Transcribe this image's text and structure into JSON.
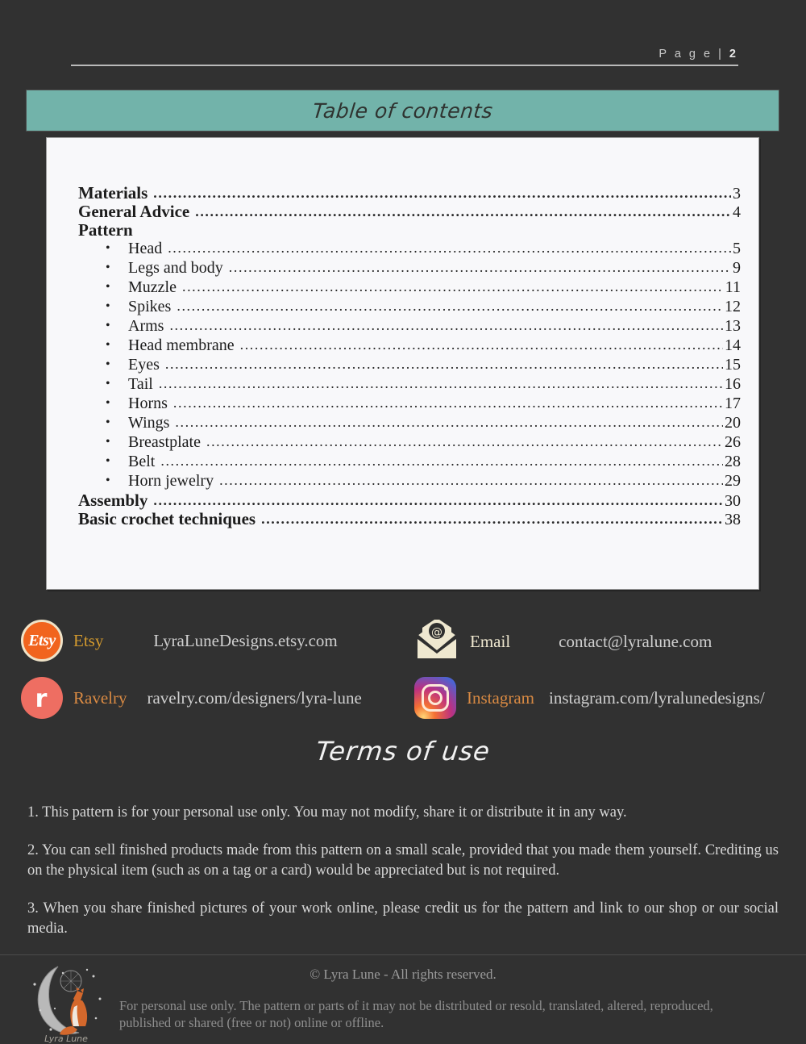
{
  "header": {
    "page_label": "P a g e  | ",
    "page_number": "2"
  },
  "toc": {
    "bar_title": "Table of contents",
    "entries": [
      {
        "label": "Materials",
        "page": "3",
        "level": 0,
        "bullet": false
      },
      {
        "label": "General Advice",
        "page": "4",
        "level": 0,
        "bullet": false
      },
      {
        "label": "Pattern",
        "page": "",
        "level": 0,
        "bullet": false,
        "nodots": true
      },
      {
        "label": "Head",
        "page": "5",
        "level": 1,
        "bullet": true
      },
      {
        "label": "Legs and body",
        "page": "9",
        "level": 1,
        "bullet": true
      },
      {
        "label": "Muzzle",
        "page": "11",
        "level": 1,
        "bullet": true
      },
      {
        "label": "Spikes",
        "page": "12",
        "level": 1,
        "bullet": true
      },
      {
        "label": "Arms",
        "page": "13",
        "level": 1,
        "bullet": true
      },
      {
        "label": "Head membrane",
        "page": "14",
        "level": 1,
        "bullet": true
      },
      {
        "label": "Eyes",
        "page": "15",
        "level": 1,
        "bullet": true
      },
      {
        "label": "Tail",
        "page": "16",
        "level": 1,
        "bullet": true
      },
      {
        "label": "Horns",
        "page": "17",
        "level": 1,
        "bullet": true
      },
      {
        "label": "Wings",
        "page": "20",
        "level": 1,
        "bullet": true
      },
      {
        "label": "Breastplate",
        "page": "26",
        "level": 1,
        "bullet": true
      },
      {
        "label": "Belt",
        "page": "28",
        "level": 1,
        "bullet": true
      },
      {
        "label": "Horn jewelry",
        "page": "29",
        "level": 1,
        "bullet": true
      },
      {
        "label": "Assembly",
        "page": "30",
        "level": 0,
        "bullet": false
      },
      {
        "label": "Basic crochet techniques",
        "page": "38",
        "level": 0,
        "bullet": false
      }
    ]
  },
  "socials": [
    {
      "icon": "etsy-icon",
      "icon_text": "Etsy",
      "name": "Etsy",
      "value": "LyraLuneDesigns.etsy.com"
    },
    {
      "icon": "email-icon",
      "icon_text": "@",
      "name": "Email",
      "value": "contact@lyralune.com"
    },
    {
      "icon": "ravelry-icon",
      "icon_text": "r",
      "name": "Ravelry",
      "value": "ravelry.com/designers/lyra-lune"
    },
    {
      "icon": "instagram-icon",
      "icon_text": "",
      "name": "Instagram",
      "value": "instagram.com/lyralunedesigns/"
    }
  ],
  "terms": {
    "title": "Terms of use",
    "paragraphs": [
      "1. This pattern is for your personal use only. You may not modify, share it or distribute it in any way.",
      "2. You can sell finished products made from this pattern on a small scale, provided that you made them yourself. Crediting us on the physical item (such as on a tag or a card) would be appreciated but is not required.",
      "3. When you share finished pictures of your work online, please credit us for the pattern and link to our shop or our social media."
    ]
  },
  "footer": {
    "logo_text": "Lyra Lune",
    "copyright": "© Lyra Lune - All rights reserved.",
    "note": "For personal use only. The pattern or parts of it may not be distributed or resold, translated, altered, reproduced, published or shared (free or not) online or offline."
  },
  "colors": {
    "background": "#313131",
    "teal_bar": "#72b3aa",
    "panel": "#f8f8fa",
    "etsy_orange": "#f1641e",
    "ravelry_salmon": "#ee6e62",
    "email_cream": "#efe8d0",
    "fox_orange": "#d4682c"
  }
}
